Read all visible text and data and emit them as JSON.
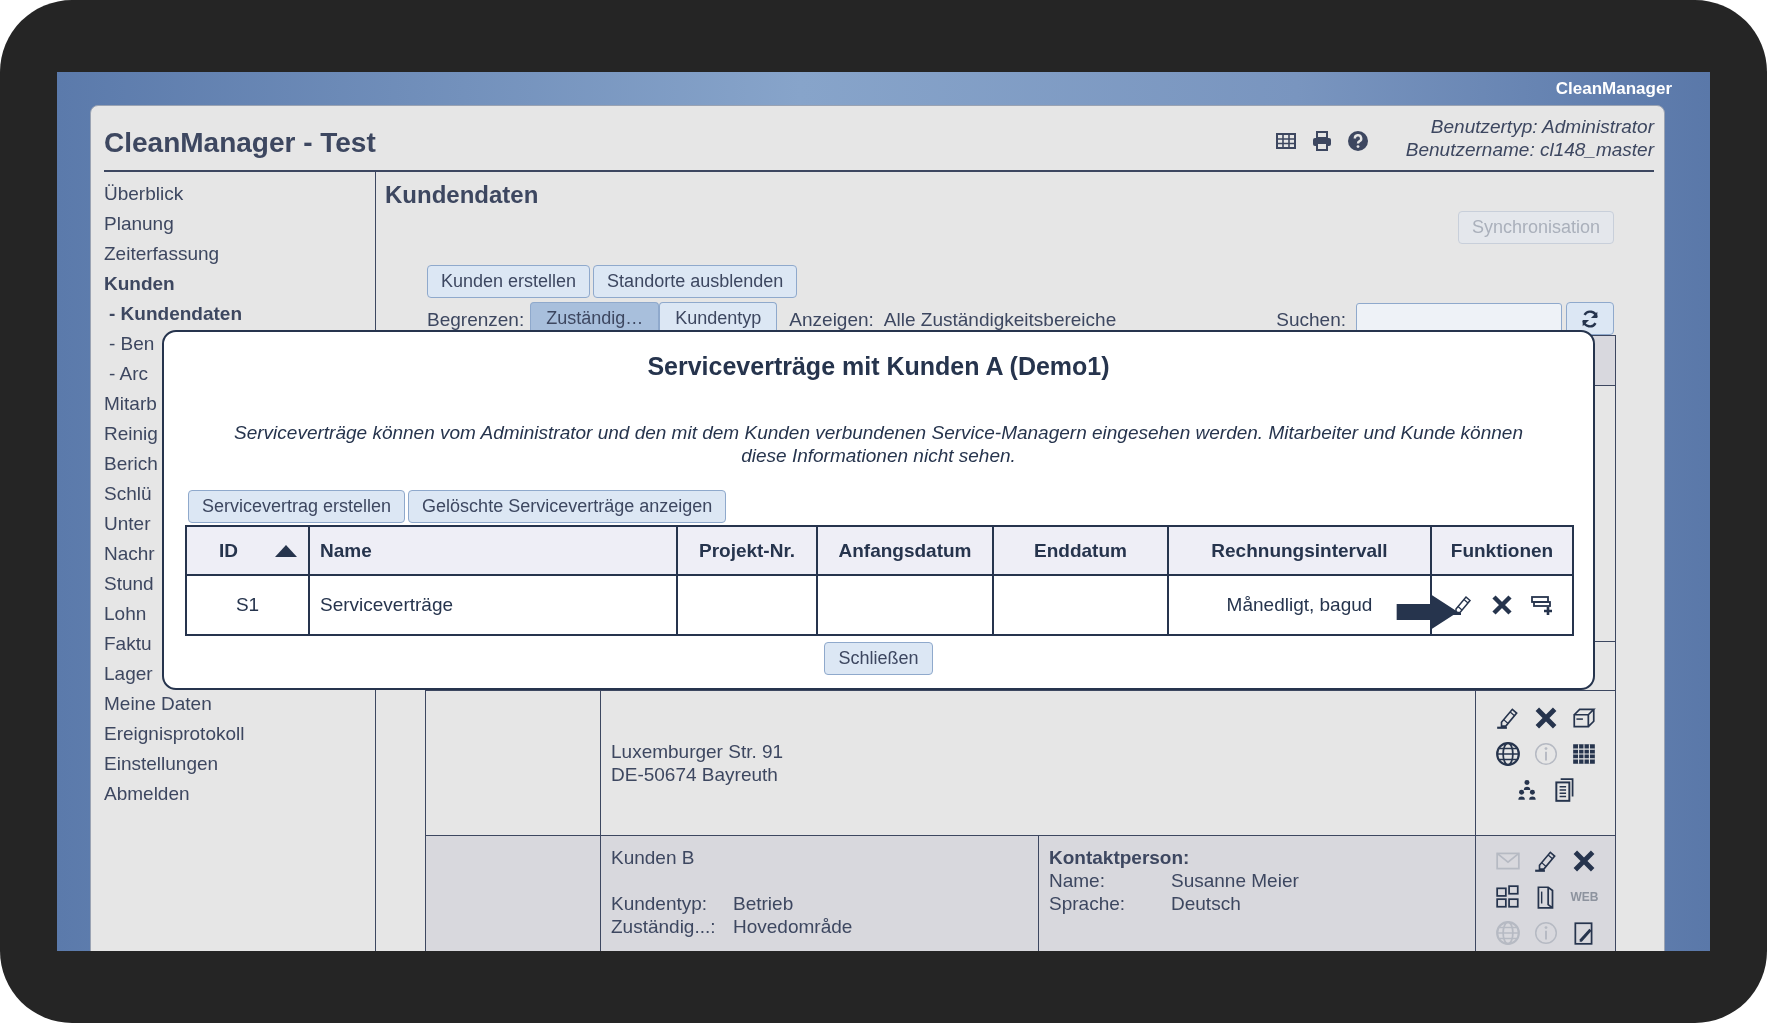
{
  "app_name": "CleanManager",
  "header": {
    "title": "CleanManager - Test",
    "icons": [
      {
        "kind": "table"
      },
      {
        "kind": "printer"
      },
      {
        "kind": "help"
      }
    ],
    "user_type": "Benutzertyp: Administrator",
    "user_name": "Benutzername: cl148_master"
  },
  "sidebar": {
    "items": [
      {
        "label": "Überblick",
        "selected": false
      },
      {
        "label": "Planung",
        "selected": false
      },
      {
        "label": "Zeiterfassung",
        "selected": false
      },
      {
        "label": "Kunden",
        "selected": true,
        "children": [
          {
            "label": "- Kundendaten",
            "selected": true
          },
          {
            "label": "- Ben",
            "selected": false
          },
          {
            "label": "- Arc",
            "selected": false
          }
        ]
      },
      {
        "label": "Mitarb",
        "selected": false
      },
      {
        "label": "Reinig",
        "selected": false
      },
      {
        "label": "Berich",
        "selected": false
      },
      {
        "label": "Schlü",
        "selected": false
      },
      {
        "label": "Unter",
        "selected": false
      },
      {
        "label": "Nachr",
        "selected": false
      },
      {
        "label": "Stund",
        "selected": false
      },
      {
        "label": "Lohn",
        "selected": false
      },
      {
        "label": "Faktu",
        "selected": false
      },
      {
        "label": "Lager",
        "selected": false
      },
      {
        "label": "Meine Daten",
        "selected": false
      },
      {
        "label": "Ereignisprotokoll",
        "selected": false
      },
      {
        "label": "Einstellungen",
        "selected": false
      },
      {
        "label": "Abmelden",
        "selected": false
      }
    ]
  },
  "main": {
    "title": "Kundendaten",
    "sync_button": {
      "label": "Synchronisation",
      "disabled": true
    },
    "buttons": [
      "Kunden erstellen",
      "Standorte ausblenden"
    ],
    "filter": {
      "label": "Begrenzen:",
      "segments": [
        {
          "label": "Zuständig…",
          "selected": true
        },
        {
          "label": "Kundentyp",
          "selected": false
        }
      ],
      "show_label": "Anzeigen:",
      "show_value": "Alle Zuständigkeitsbereiche",
      "search_label": "Suchen:"
    },
    "customers": [
      {
        "address": [
          "Luxemburger Str. 91",
          "DE-50674 Bayreuth"
        ],
        "functions": [
          {
            "kind": "pencil",
            "disabled": false
          },
          {
            "kind": "cross",
            "disabled": false
          },
          {
            "kind": "box",
            "disabled": false
          },
          {
            "kind": "globe",
            "disabled": false
          },
          {
            "kind": "info",
            "disabled": true
          },
          {
            "kind": "grid",
            "disabled": false
          },
          {
            "kind": "people",
            "disabled": false
          },
          {
            "kind": "documents",
            "disabled": false
          }
        ]
      },
      {
        "name": "Kunden B",
        "fields": [
          {
            "label": "Kundentyp:",
            "value": "Betrieb"
          },
          {
            "label": "Zuständig...:",
            "value": "Hovedområde"
          }
        ],
        "contact": {
          "title": "Kontaktperson:",
          "fields": [
            {
              "label": "Name:",
              "value": "Susanne Meier"
            },
            {
              "label": "Sprache:",
              "value": "Deutsch"
            }
          ]
        },
        "functions": [
          {
            "kind": "envelope",
            "disabled": true
          },
          {
            "kind": "pencil",
            "disabled": false
          },
          {
            "kind": "cross",
            "disabled": false
          },
          {
            "kind": "blocks",
            "disabled": false
          },
          {
            "kind": "book",
            "disabled": false
          },
          {
            "kind": "text",
            "label": "WEB",
            "disabled": true
          },
          {
            "kind": "globe",
            "disabled": true
          },
          {
            "kind": "info",
            "disabled": true
          },
          {
            "kind": "edit-document",
            "disabled": false
          }
        ]
      }
    ]
  },
  "modal": {
    "title": "Serviceverträge mit Kunden A (Demo1)",
    "note": "Serviceverträge können vom Administrator und den mit dem Kunden verbundenen Service-Managern eingesehen werden. Mitarbeiter und Kunde können diese Informationen nicht sehen.",
    "buttons": [
      "Servicevertrag erstellen",
      "Gelöschte Serviceverträge anzeigen"
    ],
    "columns": [
      {
        "label": "ID",
        "sorted_ascending": true
      },
      {
        "label": "Name"
      },
      {
        "label": "Projekt-Nr."
      },
      {
        "label": "Anfangsdatum"
      },
      {
        "label": "Enddatum"
      },
      {
        "label": "Rechnungsintervall"
      },
      {
        "label": "Funktionen"
      }
    ],
    "rows": [
      {
        "id": "S1",
        "name": "Serviceverträge",
        "interval": "Månedligt, bagud",
        "functions": [
          {
            "kind": "pencil"
          },
          {
            "kind": "cross"
          },
          {
            "kind": "add-row"
          }
        ]
      }
    ],
    "pointer_arrow": true,
    "close_button": "Schließen"
  }
}
